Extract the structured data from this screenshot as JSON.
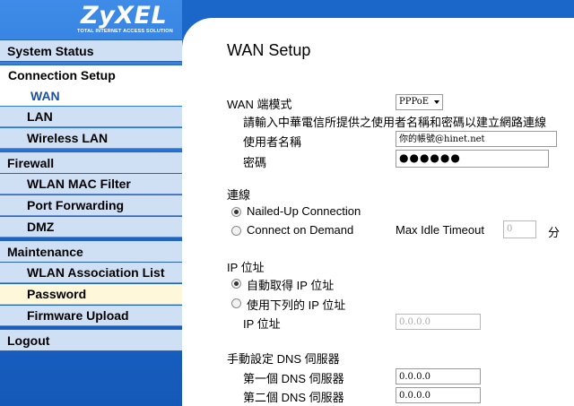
{
  "logo": {
    "brand": "ZyXEL",
    "tagline": "TOTAL INTERNET ACCESS SOLUTION"
  },
  "sidebar": {
    "system_status": "System Status",
    "connection_setup": "Connection Setup",
    "wan": "WAN",
    "lan": "LAN",
    "wireless_lan": "Wireless LAN",
    "firewall": "Firewall",
    "wlan_mac_filter": "WLAN MAC Filter",
    "port_forwarding": "Port Forwarding",
    "dmz": "DMZ",
    "maintenance": "Maintenance",
    "wlan_association_list": "WLAN Association List",
    "password": "Password",
    "firmware_upload": "Firmware Upload",
    "logout": "Logout"
  },
  "main": {
    "title": "WAN Setup",
    "wan_mode": {
      "label": "WAN 端模式",
      "value": "PPPoE"
    },
    "instruction": "請輸入中華電信所提供之使用者名稱和密碼以建立網路連線",
    "username": {
      "label": "使用者名稱",
      "value": "你的帳號@hinet.net"
    },
    "password": {
      "label": "密碼",
      "value": "●●●●●●"
    },
    "connection": {
      "heading": "連線",
      "nailed_up": "Nailed-Up Connection",
      "on_demand": "Connect on Demand",
      "max_idle_label": "Max Idle Timeout",
      "max_idle_value": "0",
      "unit": "分",
      "selected": "nailed_up"
    },
    "ip": {
      "heading": "IP 位址",
      "auto": "自動取得 IP 位址",
      "manual": "使用下列的 IP 位址",
      "address_label": "IP 位址",
      "address_value": "0.0.0.0",
      "selected": "auto"
    },
    "dns": {
      "heading": "手動設定 DNS 伺服器",
      "primary_label": "第一個 DNS 伺服器",
      "primary_value": "0.0.0.0",
      "secondary_label": "第二個 DNS 伺服器",
      "secondary_value": "0.0.0.0"
    }
  }
}
